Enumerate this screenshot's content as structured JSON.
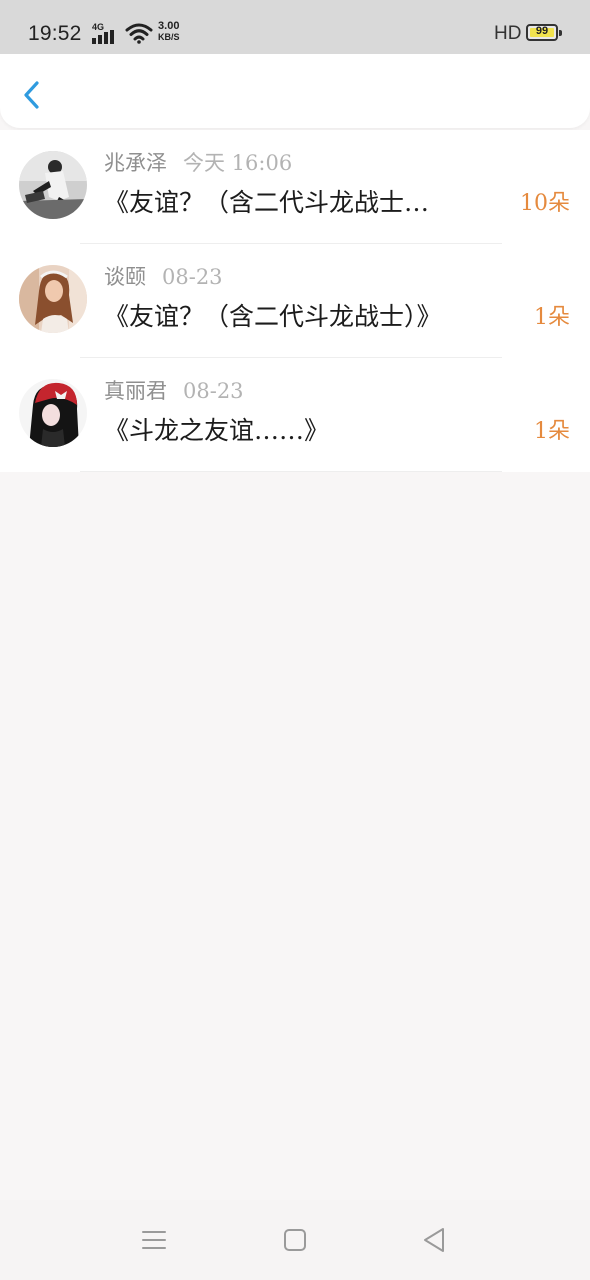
{
  "status_bar": {
    "time": "19:52",
    "network_type": "4G",
    "speed_value": "3.00",
    "speed_unit": "KB/S",
    "hd_label": "HD",
    "battery_level": "99",
    "icons": [
      "signal-icon",
      "wifi-icon",
      "battery-icon"
    ]
  },
  "header": {
    "back_icon": "chevron-left-icon",
    "accent_color": "#2f9bdf"
  },
  "colors": {
    "count": "#e58a3e",
    "title": "#1c1c1c",
    "meta": "#9a9a9a"
  },
  "list": {
    "items": [
      {
        "name": "兆承泽",
        "date": "今天 16:06",
        "title": "《友谊？（含二代斗龙战士…",
        "count": "10朵"
      },
      {
        "name": "谈颐",
        "date": "08-23",
        "title": "《友谊？（含二代斗龙战士）》",
        "count": "1朵"
      },
      {
        "name": "真丽君",
        "date": "08-23",
        "title": "《斗龙之友谊……》",
        "count": "1朵"
      }
    ]
  },
  "nav_bar": {
    "icons": [
      "menu-icon",
      "home-icon",
      "back-icon"
    ]
  }
}
